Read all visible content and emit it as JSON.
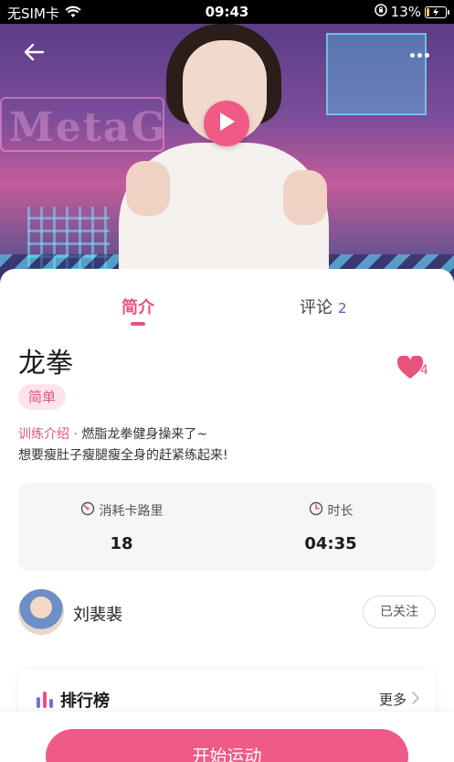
{
  "status_bar": {
    "carrier": "无SIM卡",
    "time": "09:43",
    "battery": "13%"
  },
  "hero": {
    "icons": {
      "back": "arrow-left-icon",
      "more": "more-dots-icon",
      "play": "play-icon"
    }
  },
  "tabs": [
    {
      "label": "简介",
      "active": true
    },
    {
      "label": "评论",
      "count": "2",
      "active": false
    }
  ],
  "workout": {
    "title": "龙拳",
    "likes": "4",
    "difficulty": "简单",
    "intro_label": "训练介绍",
    "intro_sep": "·",
    "intro_line1": "燃脂龙拳健身操来了~",
    "intro_line2": "想要瘦肚子瘦腿瘦全身的赶紧练起来!"
  },
  "stats": {
    "calories_label": "消耗卡路里",
    "calories_value": "18",
    "duration_label": "时长",
    "duration_value": "04:35"
  },
  "author": {
    "name": "刘裴裴",
    "follow_label": "已关注"
  },
  "ranking": {
    "title": "排行榜",
    "more_label": "更多"
  },
  "actions": {
    "start_label": "开始运动"
  },
  "colors": {
    "accent": "#e8527c",
    "button": "#ef5a86",
    "tag_bg": "#fde4ea",
    "comment_count": "#5a5ab8"
  }
}
